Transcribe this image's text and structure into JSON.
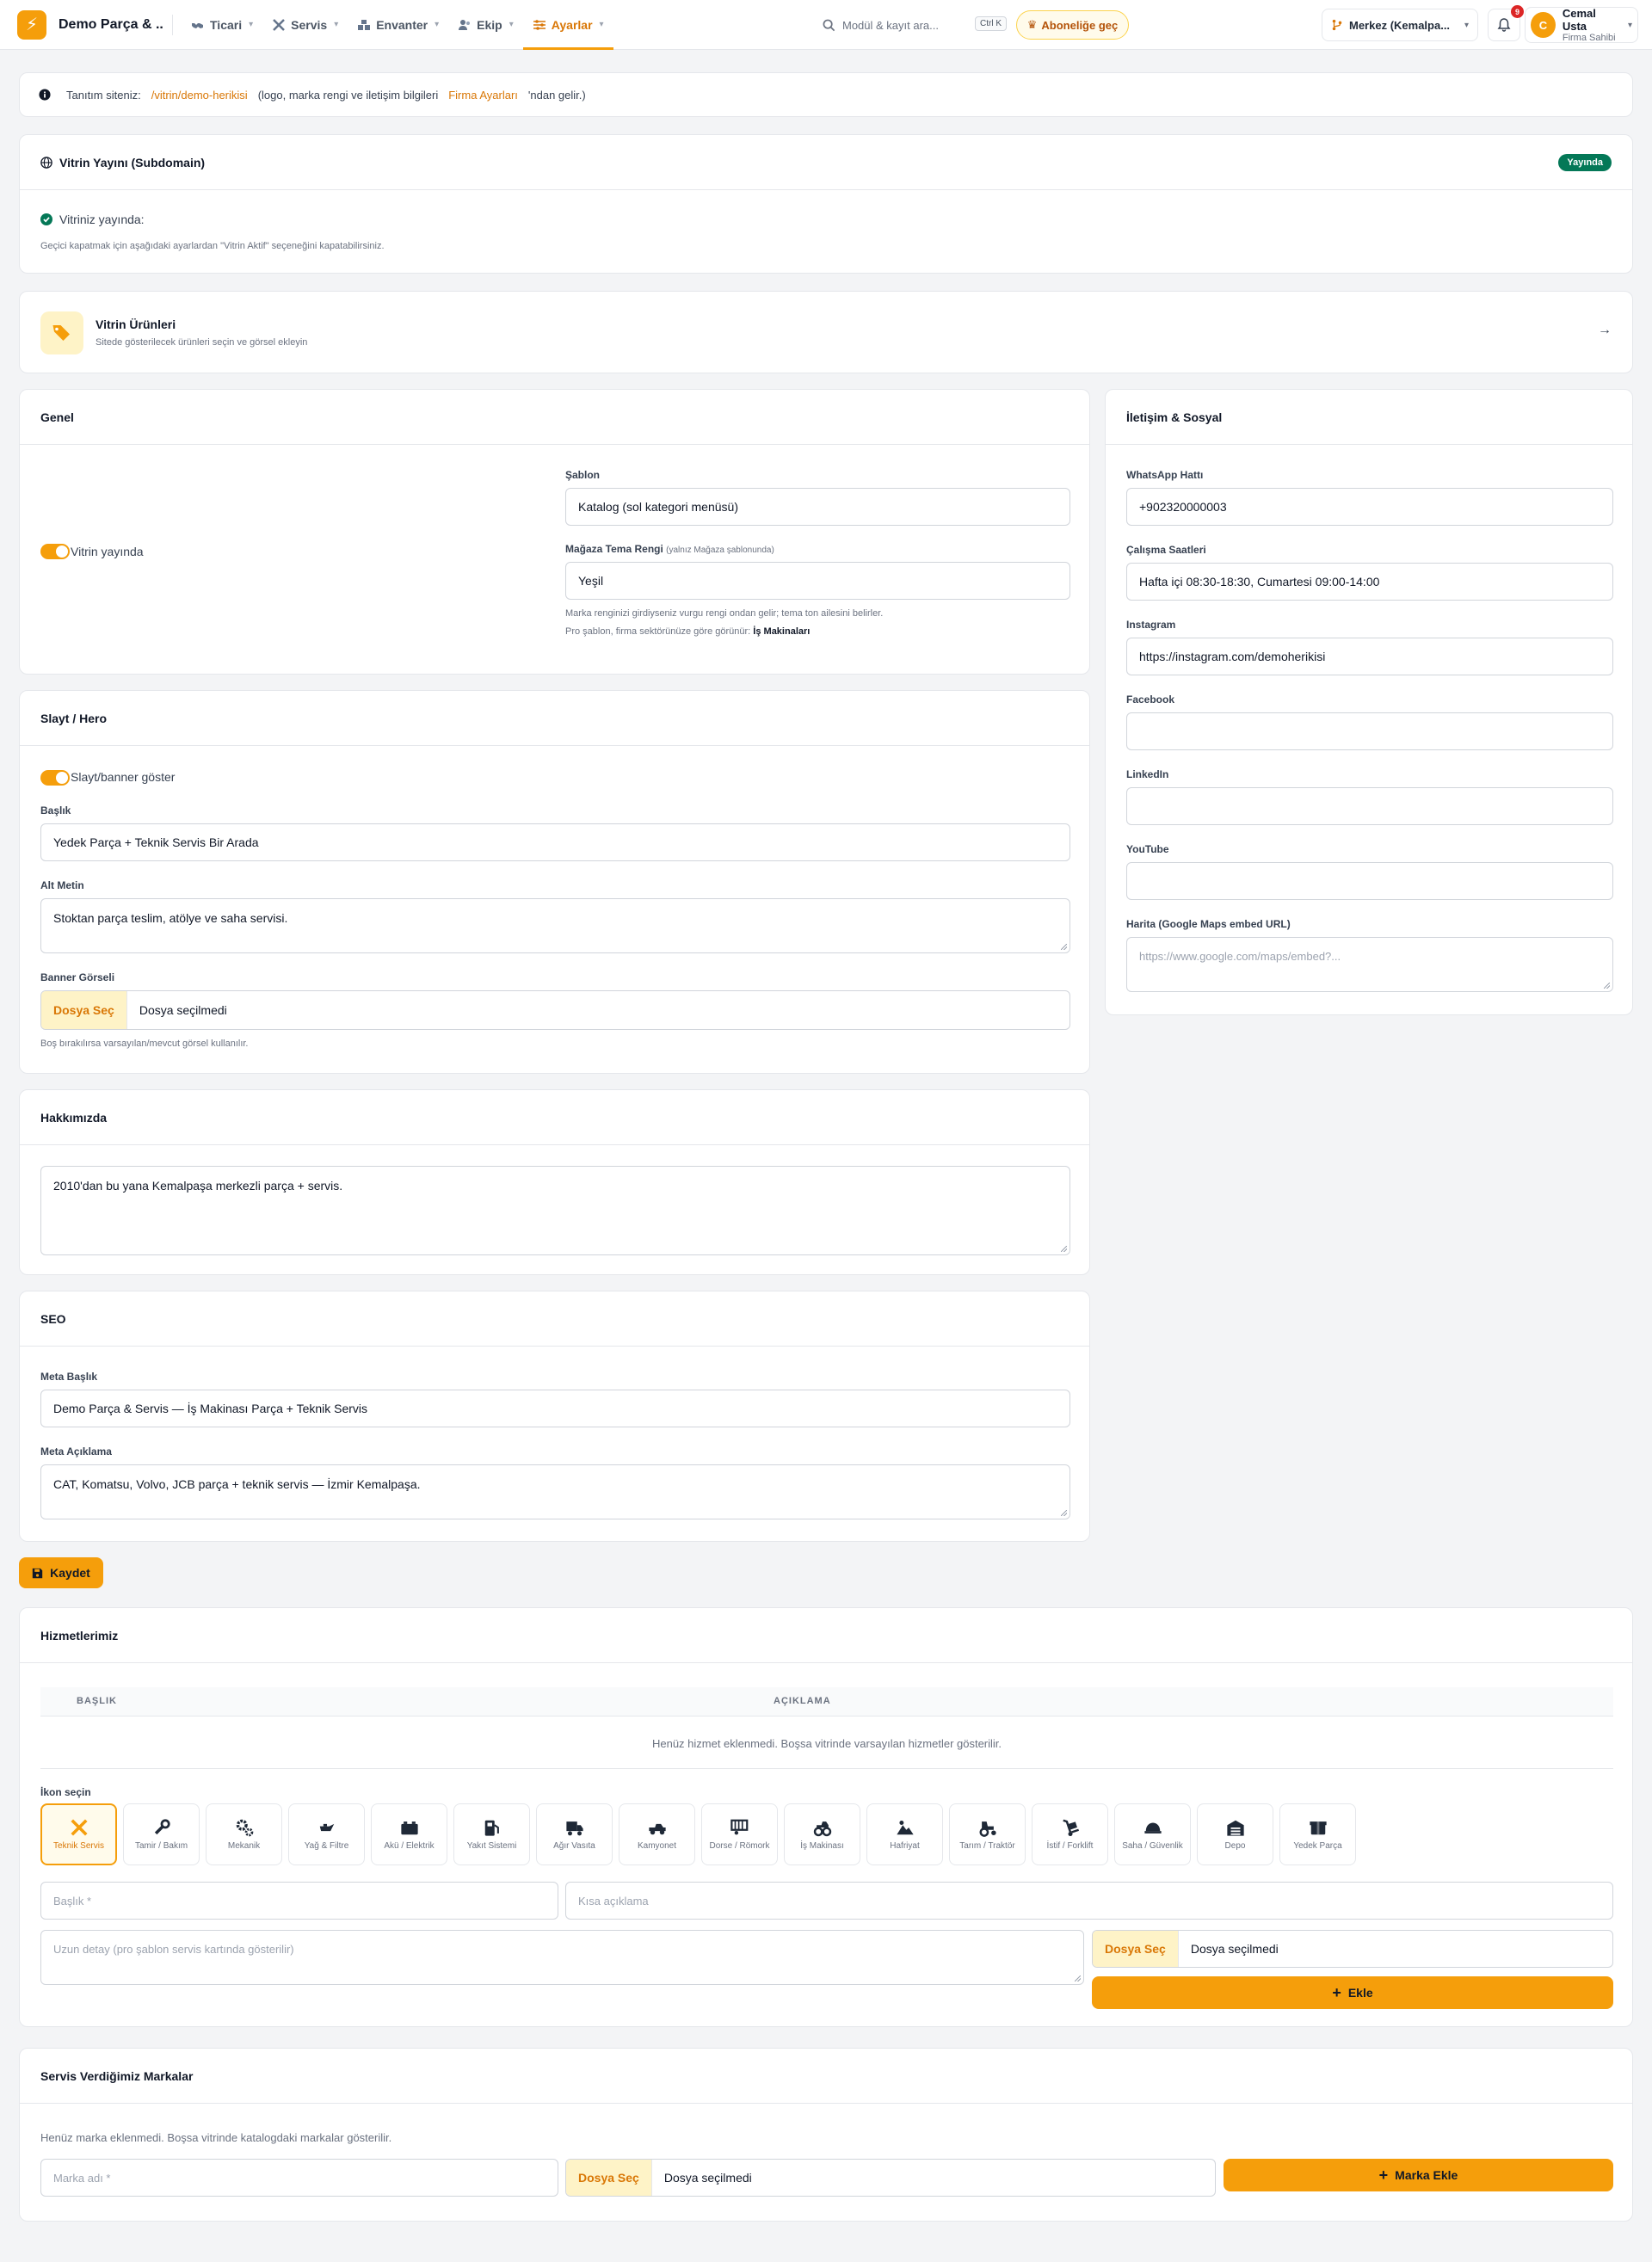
{
  "app": {
    "name": "Demo Parça & ...",
    "logo_icon": "bolt-icon"
  },
  "nav": [
    {
      "label": "Ticari",
      "icon": "handshake-icon"
    },
    {
      "label": "Servis",
      "icon": "tools-icon"
    },
    {
      "label": "Envanter",
      "icon": "warehouse-icon"
    },
    {
      "label": "Ekip",
      "icon": "users-icon"
    },
    {
      "label": "Ayarlar",
      "icon": "sliders-icon",
      "active": true
    }
  ],
  "search": {
    "placeholder": "Modül & kayıt ara...",
    "shortcut": "Ctrl K"
  },
  "subscribe": {
    "label": "Aboneliğe geç"
  },
  "branch": {
    "label": "Merkez (Kemalpa..."
  },
  "notifications": {
    "count": "9"
  },
  "user": {
    "initial": "C",
    "name": "Cemal Usta",
    "role": "Firma Sahibi"
  },
  "info": {
    "prefix": "Tanıtım siteniz:",
    "link": "/vitrin/demo-herikisi",
    "middle": "(logo, marka rengi ve iletişim bilgileri",
    "link2": "Firma Ayarları",
    "suffix": "'ndan gelir.)"
  },
  "publish": {
    "title": "Vitrin Yayını (Subdomain)",
    "status": "Yayında",
    "live_text": "Vitriniz yayında:",
    "hint": "Geçici kapatmak için aşağıdaki ayarlardan \"Vitrin Aktif\" seçeneğini kapatabilirsiniz."
  },
  "products": {
    "title": "Vitrin Ürünleri",
    "subtitle": "Sitede gösterilecek ürünleri seçin ve görsel ekleyin"
  },
  "general": {
    "title": "Genel",
    "toggle_label": "Vitrin yayında",
    "template_label": "Şablon",
    "template_value": "Katalog (sol kategori menüsü)",
    "theme_label": "Mağaza Tema Rengi",
    "theme_hint": "(yalnız Mağaza şablonunda)",
    "theme_value": "Yeşil",
    "note1": "Marka renginizi girdiyseniz vurgu rengi ondan gelir; tema ton ailesini belirler.",
    "note2": "Pro şablon, firma sektörünüze göre görünür:",
    "note2_bold": "İş Makinaları"
  },
  "contact": {
    "title": "İletişim & Sosyal",
    "fields": [
      {
        "label": "WhatsApp Hattı",
        "value": "+902320000003",
        "placeholder": ""
      },
      {
        "label": "Çalışma Saatleri",
        "value": "Hafta içi 08:30-18:30, Cumartesi 09:00-14:00",
        "placeholder": ""
      },
      {
        "label": "Instagram",
        "value": "https://instagram.com/demoherikisi",
        "placeholder": ""
      },
      {
        "label": "Facebook",
        "value": "",
        "placeholder": ""
      },
      {
        "label": "LinkedIn",
        "value": "",
        "placeholder": ""
      },
      {
        "label": "YouTube",
        "value": "",
        "placeholder": ""
      }
    ],
    "map_label": "Harita (Google Maps embed URL)",
    "map_placeholder": "https://www.google.com/maps/embed?..."
  },
  "hero": {
    "title": "Slayt / Hero",
    "toggle_label": "Slayt/banner göster",
    "heading_label": "Başlık",
    "heading_value": "Yedek Parça + Teknik Servis Bir Arada",
    "sub_label": "Alt Metin",
    "sub_value": "Stoktan parça teslim, atölye ve saha servisi.",
    "banner_label": "Banner Görseli",
    "file_btn": "Dosya Seç",
    "file_text": "Dosya seçilmedi",
    "banner_hint": "Boş bırakılırsa varsayılan/mevcut görsel kullanılır."
  },
  "about": {
    "title": "Hakkımızda",
    "value": "2010'dan bu yana Kemalpaşa merkezli parça + servis."
  },
  "seo": {
    "title": "SEO",
    "meta_title_label": "Meta Başlık",
    "meta_title_value": "Demo Parça & Servis — İş Makinası Parça + Teknik Servis",
    "meta_desc_label": "Meta Açıklama",
    "meta_desc_value": "CAT, Komatsu, Volvo, JCB parça + teknik servis — İzmir Kemalpaşa."
  },
  "save": {
    "label": "Kaydet"
  },
  "services": {
    "title": "Hizmetlerimiz",
    "col_title": "BAŞLIK",
    "col_desc": "AÇIKLAMA",
    "empty": "Henüz hizmet eklenmedi. Boşsa vitrinde varsayılan hizmetler gösterilir.",
    "icon_label": "İkon seçin",
    "icons": [
      {
        "label": "Teknik Servis",
        "icon": "tools-icon",
        "selected": true
      },
      {
        "label": "Tamir / Bakım",
        "icon": "wrench-icon"
      },
      {
        "label": "Mekanik",
        "icon": "cogs-icon"
      },
      {
        "label": "Yağ & Filtre",
        "icon": "oil-can-icon"
      },
      {
        "label": "Akü / Elektrik",
        "icon": "battery-icon"
      },
      {
        "label": "Yakıt Sistemi",
        "icon": "gas-pump-icon"
      },
      {
        "label": "Ağır Vasıta",
        "icon": "truck-icon"
      },
      {
        "label": "Kamyonet",
        "icon": "pickup-icon"
      },
      {
        "label": "Dorse / Römork",
        "icon": "trailer-icon"
      },
      {
        "label": "İş Makinası",
        "icon": "monster-truck-icon"
      },
      {
        "label": "Hafriyat",
        "icon": "hill-icon"
      },
      {
        "label": "Tarım / Traktör",
        "icon": "tractor-icon"
      },
      {
        "label": "İstif / Forklift",
        "icon": "dolly-icon"
      },
      {
        "label": "Saha / Güvenlik",
        "icon": "hard-hat-icon"
      },
      {
        "label": "Depo",
        "icon": "warehouse-icon"
      },
      {
        "label": "Yedek Parça",
        "icon": "box-icon"
      }
    ],
    "title_placeholder": "Başlık *",
    "desc_placeholder": "Kısa açıklama",
    "detail_placeholder": "Uzun detay (pro şablon servis kartında gösterilir)",
    "file_btn": "Dosya Seç",
    "file_text": "Dosya seçilmedi",
    "add_label": "Ekle"
  },
  "brands": {
    "title": "Servis Verdiğimiz Markalar",
    "empty": "Henüz marka eklenmedi. Boşsa vitrinde katalogdaki markalar gösterilir.",
    "name_placeholder": "Marka adı *",
    "file_btn": "Dosya Seç",
    "file_text": "Dosya seçilmedi",
    "add_label": "Marka Ekle"
  },
  "colors": {
    "accent": "#f59e0b",
    "live": "#047857",
    "link": "#d97706"
  }
}
